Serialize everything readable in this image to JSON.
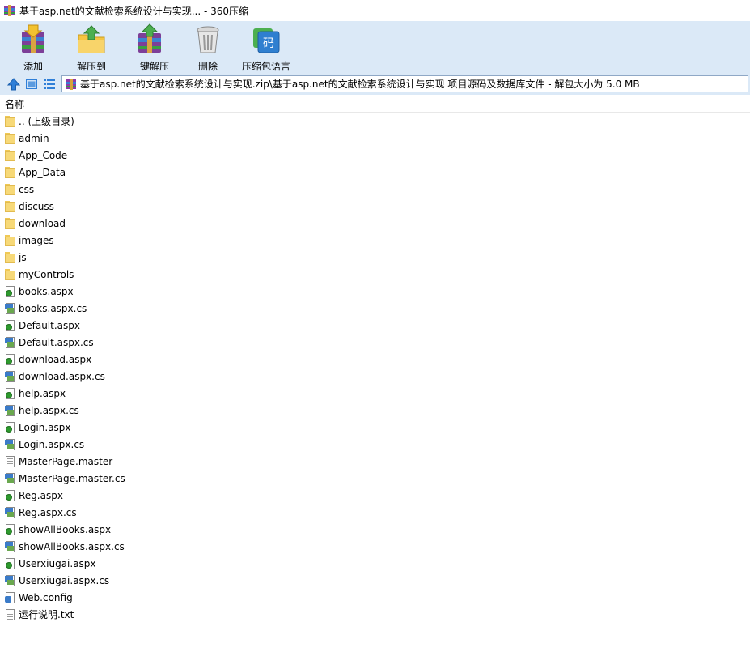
{
  "window": {
    "title": "基于asp.net的文献检索系统设计与实现... - 360压缩"
  },
  "toolbar": {
    "items": [
      {
        "label": "添加",
        "icon": "add-archive-icon"
      },
      {
        "label": "解压到",
        "icon": "extract-to-icon"
      },
      {
        "label": "一键解压",
        "icon": "one-click-extract-icon"
      },
      {
        "label": "删除",
        "icon": "delete-trash-icon"
      },
      {
        "label": "压缩包语言",
        "icon": "archive-language-icon"
      }
    ]
  },
  "address": {
    "path": "基于asp.net的文献检索系统设计与实现.zip\\基于asp.net的文献检索系统设计与实现 项目源码及数据库文件 - 解包大小为 5.0 MB"
  },
  "list": {
    "header_name": "名称",
    "rows": [
      {
        "name": ".. (上级目录)",
        "type": "folder"
      },
      {
        "name": "admin",
        "type": "folder"
      },
      {
        "name": "App_Code",
        "type": "folder"
      },
      {
        "name": "App_Data",
        "type": "folder"
      },
      {
        "name": "css",
        "type": "folder"
      },
      {
        "name": "discuss",
        "type": "folder"
      },
      {
        "name": "download",
        "type": "folder"
      },
      {
        "name": "images",
        "type": "folder"
      },
      {
        "name": "js",
        "type": "folder"
      },
      {
        "name": "myControls",
        "type": "folder"
      },
      {
        "name": "books.aspx",
        "type": "aspx"
      },
      {
        "name": "books.aspx.cs",
        "type": "cs"
      },
      {
        "name": "Default.aspx",
        "type": "aspx"
      },
      {
        "name": "Default.aspx.cs",
        "type": "cs"
      },
      {
        "name": "download.aspx",
        "type": "aspx"
      },
      {
        "name": "download.aspx.cs",
        "type": "cs"
      },
      {
        "name": "help.aspx",
        "type": "aspx"
      },
      {
        "name": "help.aspx.cs",
        "type": "cs"
      },
      {
        "name": "Login.aspx",
        "type": "aspx"
      },
      {
        "name": "Login.aspx.cs",
        "type": "cs"
      },
      {
        "name": "MasterPage.master",
        "type": "master"
      },
      {
        "name": "MasterPage.master.cs",
        "type": "cs"
      },
      {
        "name": "Reg.aspx",
        "type": "aspx"
      },
      {
        "name": "Reg.aspx.cs",
        "type": "cs"
      },
      {
        "name": "showAllBooks.aspx",
        "type": "aspx"
      },
      {
        "name": "showAllBooks.aspx.cs",
        "type": "cs"
      },
      {
        "name": "Userxiugai.aspx",
        "type": "aspx"
      },
      {
        "name": "Userxiugai.aspx.cs",
        "type": "cs"
      },
      {
        "name": "Web.config",
        "type": "config"
      },
      {
        "name": "运行说明.txt",
        "type": "txt"
      }
    ]
  }
}
